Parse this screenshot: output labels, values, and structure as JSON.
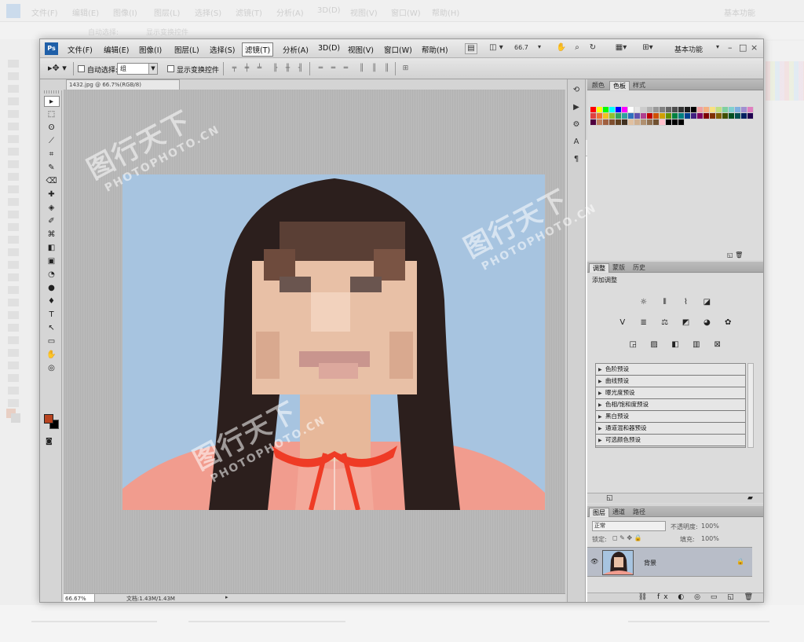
{
  "background_app": {
    "menu": [
      "文件(F)",
      "编辑(E)",
      "图像(I)",
      "图层(L)",
      "选择(S)",
      "滤镜(T)",
      "分析(A)",
      "3D(D)",
      "视图(V)",
      "窗口(W)",
      "帮助(H)"
    ],
    "workspace": "基本功能"
  },
  "menubar": {
    "logo": "Ps",
    "items": [
      "文件(F)",
      "编辑(E)",
      "图像(I)",
      "图层(L)",
      "选择(S)",
      "滤镜(T)",
      "分析(A)",
      "3D(D)",
      "视图(V)",
      "窗口(W)",
      "帮助(H)"
    ],
    "zoom": "66.7",
    "workspace": "基本功能",
    "window_controls": [
      "–",
      "□",
      "×"
    ]
  },
  "options_bar": {
    "auto_select_label": "自动选择:",
    "auto_select_value": "组",
    "show_transform_label": "显示变换控件"
  },
  "toolbox": {
    "tools": [
      "▸",
      "⬚",
      "ʘ",
      "⟋",
      "⌗",
      "✎",
      "⌫",
      "✚",
      "◈",
      "✐",
      "⌘",
      "◧",
      "▣",
      "◔",
      "●",
      "♦",
      "T",
      "↖",
      "▭",
      "✋",
      "◎"
    ],
    "foreground_color": "#b94420",
    "background_color": "#000000",
    "quick_mask_icon": "quick-mask-icon"
  },
  "document": {
    "tab_title": "1432.jpg @ 66.7%(RGB/8)",
    "zoom_status": "66.67%",
    "status_info": "文档:1.43M/1.43M"
  },
  "swatches_panel": {
    "tabs": [
      "颜色",
      "色板",
      "样式"
    ],
    "active_tab": 1,
    "colors": [
      "#ff0000",
      "#ffff00",
      "#00ff00",
      "#00ffff",
      "#0000ff",
      "#ff00ff",
      "#ffffff",
      "#e5e5e5",
      "#cccccc",
      "#b3b3b3",
      "#999999",
      "#808080",
      "#666666",
      "#4d4d4d",
      "#333333",
      "#1a1a1a",
      "#000000",
      "#f0a0a0",
      "#f5b080",
      "#f8e080",
      "#c0e080",
      "#80d0a0",
      "#80d0d0",
      "#80b0e0",
      "#a090d0",
      "#e080c0",
      "#e04040",
      "#f07030",
      "#f0c020",
      "#90c030",
      "#30a060",
      "#30a0a0",
      "#3070c0",
      "#6050b0",
      "#b04090",
      "#c00000",
      "#d05000",
      "#d0a000",
      "#609000",
      "#008040",
      "#008080",
      "#004090",
      "#402080",
      "#800060",
      "#800000",
      "#803000",
      "#806000",
      "#405000",
      "#005020",
      "#005050",
      "#002060",
      "#200050",
      "#500040",
      "#c08060",
      "#a06040",
      "#805030",
      "#604020",
      "#403020",
      "#e0c0a0",
      "#d0b090",
      "#b09070",
      "#907050",
      "#705030",
      "#ffc0cb",
      "#000000",
      "#000000",
      "#000000"
    ]
  },
  "adjustments_panel": {
    "tabs": [
      "调整",
      "蒙版",
      "历史"
    ],
    "active_tab": 0,
    "title": "添加调整",
    "row1_icons": [
      "brightness-icon",
      "levels-icon",
      "curves-icon",
      "exposure-icon"
    ],
    "row2_icons": [
      "vibrance-icon",
      "hue-saturation-icon",
      "color-balance-icon",
      "black-white-icon",
      "photo-filter-icon",
      "channel-mixer-icon"
    ],
    "row3_icons": [
      "invert-icon",
      "posterize-icon",
      "threshold-icon",
      "gradient-map-icon",
      "selective-color-icon"
    ],
    "presets": [
      "色阶预设",
      "曲线预设",
      "曝光度预设",
      "色相/饱和度预设",
      "黑白预设",
      "通道混和器预设",
      "可选颜色预设"
    ]
  },
  "layers_panel": {
    "tabs": [
      "图层",
      "通道",
      "路径"
    ],
    "active_tab": 0,
    "blend_mode": "正常",
    "opacity_label": "不透明度:",
    "opacity_value": "100%",
    "lock_label": "锁定:",
    "fill_label": "填充:",
    "fill_value": "100%",
    "layers": [
      {
        "name": "背景",
        "visible": true,
        "locked": true
      }
    ]
  },
  "watermark": {
    "cn": "图行天下",
    "en": "PHOTOPHOTO.CN"
  }
}
